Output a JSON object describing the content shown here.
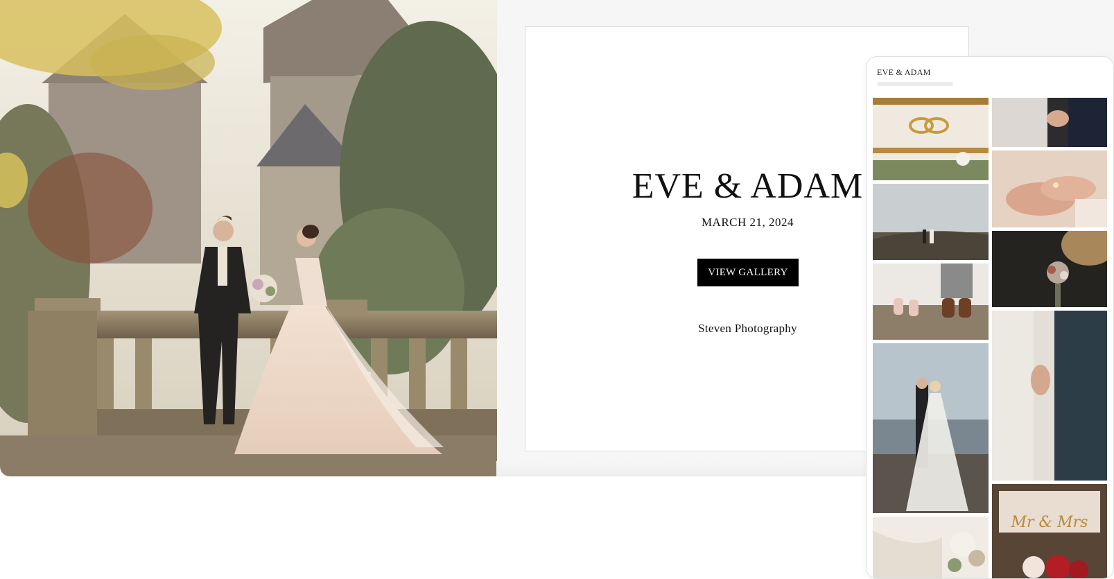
{
  "hero": {
    "image_alt": "Bride and groom on a stone balcony in front of a castle"
  },
  "gallery_page": {
    "title": "EVE & ADAM",
    "date": "MARCH 21, 2024",
    "view_gallery_label": "VIEW GALLERY",
    "photographer": "Steven Photography"
  },
  "mobile": {
    "title": "EVE & ADAM",
    "photos": [
      {
        "name": "rings"
      },
      {
        "name": "couple-on-hill"
      },
      {
        "name": "couple-shoes"
      },
      {
        "name": "couple-on-beach"
      },
      {
        "name": "dress-detail"
      },
      {
        "name": "holding-hands-lace"
      },
      {
        "name": "hands-with-ring"
      },
      {
        "name": "bouquet"
      },
      {
        "name": "holding-hands-suit"
      },
      {
        "name": "cake-topper"
      }
    ],
    "cake_topper_text": "Mr & Mrs"
  }
}
